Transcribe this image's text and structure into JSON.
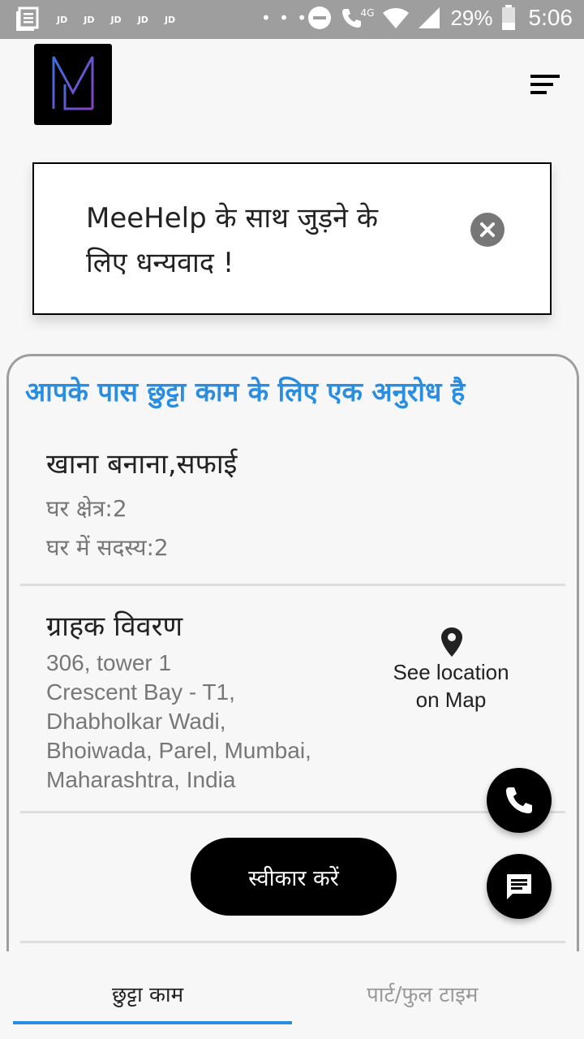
{
  "status_bar": {
    "notifications": [
      "JD",
      "JD",
      "JD",
      "JD",
      "JD"
    ],
    "more": "• • •",
    "network": "4G",
    "battery": "29%",
    "time": "5:06"
  },
  "welcome": {
    "message": "MeeHelp के साथ जुड़ने के लिए धन्यवाद !"
  },
  "request": {
    "heading": "आपके पास छुट्टा काम के लिए एक अनुरोध है",
    "job_title": "खाना बनाना,सफाई",
    "house_area": "घर क्षेत्र:2",
    "members": "घर में सदस्य:2",
    "customer_title": "ग्राहक विवरण",
    "address_lines": [
      "306, tower 1",
      "Crescent Bay - T1,",
      "Dhabholkar Wadi,",
      "Bhoiwada, Parel, Mumbai,",
      "Maharashtra, India"
    ],
    "location_line1": "See location",
    "location_line2": "on Map",
    "accept_label": "स्वीकार करें"
  },
  "tabs": {
    "active": "छुट्टा काम",
    "inactive": "पार्ट/फुल टाइम"
  },
  "colors": {
    "accent": "#2a8de0",
    "status_bar": "#9e9e9e"
  }
}
